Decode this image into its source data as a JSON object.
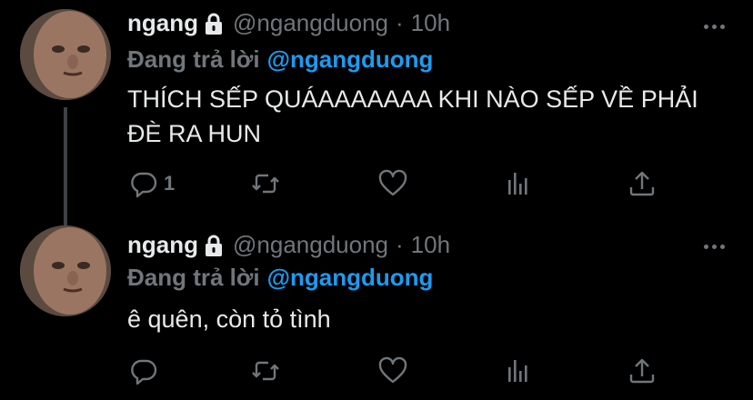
{
  "tweets": [
    {
      "display_name": "ngang",
      "handle": "@ngangduong",
      "separator": "·",
      "time": "10h",
      "reply_prefix": "Đang trả lời",
      "reply_mention": "@ngangduong",
      "text": "THÍCH SẾP QUÁAAAAAAA KHI NÀO SẾP VỀ PHẢI ĐÈ RA HUN",
      "reply_count": "1",
      "icons": [
        "lock-icon",
        "more-icon",
        "reply-icon",
        "retweet-icon",
        "like-icon",
        "stats-icon",
        "share-icon"
      ]
    },
    {
      "display_name": "ngang",
      "handle": "@ngangduong",
      "separator": "·",
      "time": "10h",
      "reply_prefix": "Đang trả lời",
      "reply_mention": "@ngangduong",
      "text": "ê quên, còn tỏ tình",
      "reply_count": "",
      "icons": [
        "lock-icon",
        "more-icon",
        "reply-icon",
        "retweet-icon",
        "like-icon",
        "stats-icon",
        "share-icon"
      ]
    }
  ],
  "colors": {
    "background": "#000000",
    "text": "#e7e9ea",
    "muted": "#71767b",
    "accent": "#1d9bf0",
    "thread_line": "#3e4144"
  }
}
